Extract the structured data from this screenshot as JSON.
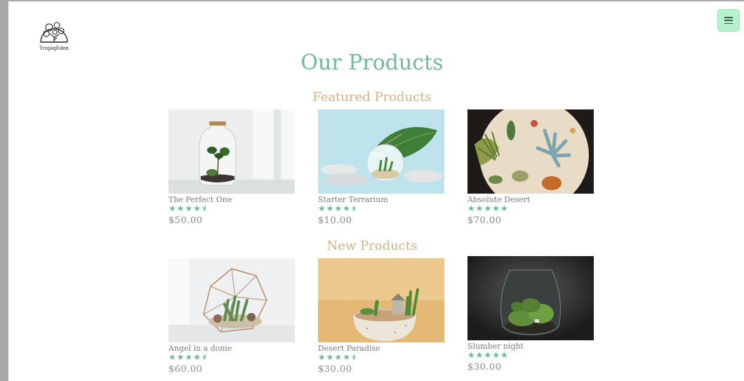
{
  "brand": {
    "name": "TropiqEden"
  },
  "header": {
    "menu_icon": "hamburger-icon",
    "menu_color": "#b6f0cc"
  },
  "page": {
    "title": "Our Products"
  },
  "colors": {
    "title": "#72b899",
    "section": "#d2b484",
    "stars": "#6fb79a",
    "text": "#7d7d7d"
  },
  "sections": [
    {
      "title": "Featured Products",
      "products": [
        {
          "name": "The Perfect One",
          "rating": 4.5,
          "stars": "★★★★⯨",
          "price": "$50.00"
        },
        {
          "name": "Starter Terrarium",
          "rating": 4.5,
          "stars": "★★★★⯨",
          "price": "$10.00"
        },
        {
          "name": "Absolute Desert",
          "rating": 5,
          "stars": "★★★★★",
          "price": "$70.00"
        }
      ]
    },
    {
      "title": "New Products",
      "products": [
        {
          "name": "Angel in a dome",
          "rating": 4.5,
          "stars": "★★★★⯨",
          "price": "$60.00"
        },
        {
          "name": "Desert Paradise",
          "rating": 4.5,
          "stars": "★★★★⯨",
          "price": "$30.00"
        },
        {
          "name": "Slumber night",
          "rating": 5,
          "stars": "★★★★★",
          "price": "$30.00"
        }
      ]
    }
  ]
}
